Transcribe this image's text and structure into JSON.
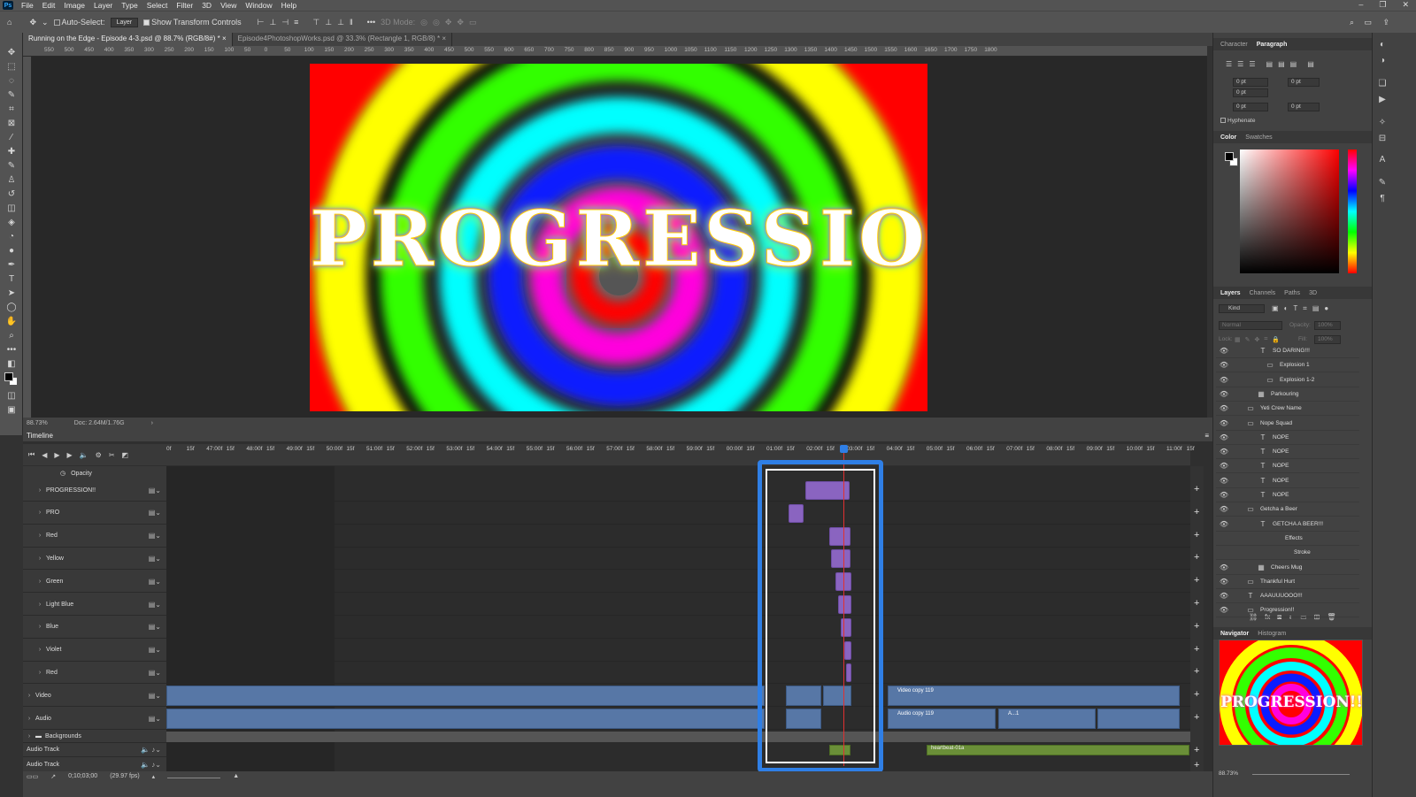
{
  "app": {
    "logo": "Ps",
    "menu": [
      "File",
      "Edit",
      "Image",
      "Layer",
      "Type",
      "Select",
      "Filter",
      "3D",
      "View",
      "Window",
      "Help"
    ]
  },
  "options": {
    "auto_select": "Auto-Select:",
    "auto_select_value": "Layer",
    "transform": "Show Transform Controls",
    "mode3d": "3D Mode:"
  },
  "doc_tabs": [
    {
      "label": "Running on the Edge - Episode 4-3.psd @ 88.7% (RGB/8#) *",
      "close": "×"
    },
    {
      "label": "Episode4PhotoshopWorks.psd @ 33.3% (Rectangle 1, RGB/8) *",
      "close": "×"
    }
  ],
  "ruler_h": [
    "550",
    "500",
    "450",
    "400",
    "350",
    "300",
    "250",
    "200",
    "150",
    "100",
    "50",
    "0",
    "50",
    "100",
    "150",
    "200",
    "250",
    "300",
    "350",
    "400",
    "450",
    "500",
    "550",
    "600",
    "650",
    "700",
    "750",
    "800",
    "850",
    "900",
    "950",
    "1000",
    "1050",
    "1100",
    "1150",
    "1200",
    "1250",
    "1300",
    "1350",
    "1400",
    "1450",
    "1500",
    "1550",
    "1600",
    "1650",
    "1700",
    "1750",
    "1800"
  ],
  "canvas": {
    "headline": "PROGRESSION!!"
  },
  "status": {
    "zoom": "88.73%",
    "doc": "Doc: 2.64M/1.76G"
  },
  "timeline": {
    "title": "Timeline",
    "ruler": [
      "0f",
      "15f",
      "47:00f",
      "15f",
      "48:00f",
      "15f",
      "49:00f",
      "15f",
      "50:00f",
      "15f",
      "51:00f",
      "15f",
      "52:00f",
      "15f",
      "53:00f",
      "15f",
      "54:00f",
      "15f",
      "55:00f",
      "15f",
      "56:00f",
      "15f",
      "57:00f",
      "15f",
      "58:00f",
      "15f",
      "59:00f",
      "15f",
      "00:00f",
      "15f",
      "01:00f",
      "15f",
      "02:00f",
      "15f",
      "03:00f",
      "15f",
      "04:00f",
      "15f",
      "05:00f",
      "15f",
      "06:00f",
      "15f",
      "07:00f",
      "15f",
      "08:00f",
      "15f",
      "09:00f",
      "15f",
      "10:00f",
      "15f",
      "11:00f",
      "15f"
    ],
    "opacity_label": "Opacity",
    "tracks": [
      "PROGRESSION!!",
      "PRO",
      "Red",
      "Yellow",
      "Green",
      "Light Blue",
      "Blue",
      "Violet",
      "Red"
    ],
    "video_label": "Video",
    "audio_label": "Audio",
    "backgrounds_label": "Backgrounds",
    "audio_track_1": "Audio Track",
    "audio_track_2": "Audio Track",
    "video_clip": "Video copy 119",
    "audio_clip": "Audio copy 119",
    "audio_clip_small": "A...1",
    "heartbeat_clip": "heartbeat-01a",
    "timecode": "0;10;03;00",
    "fps": "(29.97 fps)"
  },
  "character_panel": {
    "tabs": [
      "Character",
      "Paragraph"
    ],
    "fields": [
      "0 pt",
      "0 pt",
      "0 pt",
      "0 pt",
      "0 pt"
    ],
    "hyphenate": "Hyphenate"
  },
  "color_panel": {
    "tabs": [
      "Color",
      "Swatches"
    ]
  },
  "layers_panel": {
    "tabs": [
      "Layers",
      "Channels",
      "Paths",
      "3D"
    ],
    "filter_kind": "Kind",
    "blend": "Normal",
    "opacity_label": "Opacity:",
    "opacity_value": "100%",
    "lock_label": "Lock:",
    "fill_label": "Fill:",
    "fill_value": "100%",
    "layers": [
      "SO DARING!!!",
      "Explosion 1",
      "Explosion 1-2",
      "Parkouring",
      "Yeti Crew Name",
      "Nope Squad",
      "NOPE",
      "NOPE",
      "NOPE",
      "NOPE",
      "NOPE",
      "Getcha a Beer",
      "GETCHA A BEER!!!",
      "Effects",
      "Stroke",
      "Cheers Mug",
      "Thankful Hurt",
      "AAAUUUOOO!!!",
      "Progression!!"
    ]
  },
  "navigator": {
    "tabs": [
      "Navigator",
      "Histogram"
    ],
    "thumb_text": "PROGRESSION!!",
    "zoom": "88.73%"
  }
}
